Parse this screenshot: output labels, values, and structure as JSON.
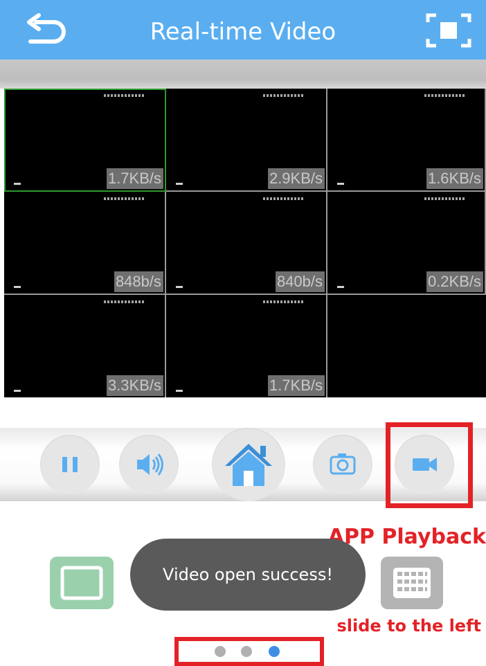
{
  "header": {
    "title": "Real-time Video",
    "back_icon": "back-arrow-icon",
    "fullscreen_icon": "fullscreen-icon",
    "color": "#5aaef0"
  },
  "video_grid": {
    "cells": [
      {
        "speed": "1.7KB/s",
        "selected": true
      },
      {
        "speed": "2.9KB/s",
        "selected": false
      },
      {
        "speed": "1.6KB/s",
        "selected": false
      },
      {
        "speed": "848b/s",
        "selected": false
      },
      {
        "speed": "840b/s",
        "selected": false
      },
      {
        "speed": "0.2KB/s",
        "selected": false
      },
      {
        "speed": "3.3KB/s",
        "selected": false
      },
      {
        "speed": "1.7KB/s",
        "selected": false
      },
      {
        "speed": "",
        "selected": false
      }
    ]
  },
  "controls": {
    "pause_icon": "pause-icon",
    "volume_icon": "speaker-icon",
    "home_icon": "home-icon",
    "snapshot_icon": "camera-icon",
    "record_icon": "video-camera-icon",
    "icon_color": "#5aaef0"
  },
  "annotations": {
    "playback_label": "APP Playback",
    "slide_label": "slide to the left",
    "color": "#e32227"
  },
  "toast": {
    "message": "Video open success!"
  },
  "pager": {
    "active_index": 2,
    "count": 3
  }
}
